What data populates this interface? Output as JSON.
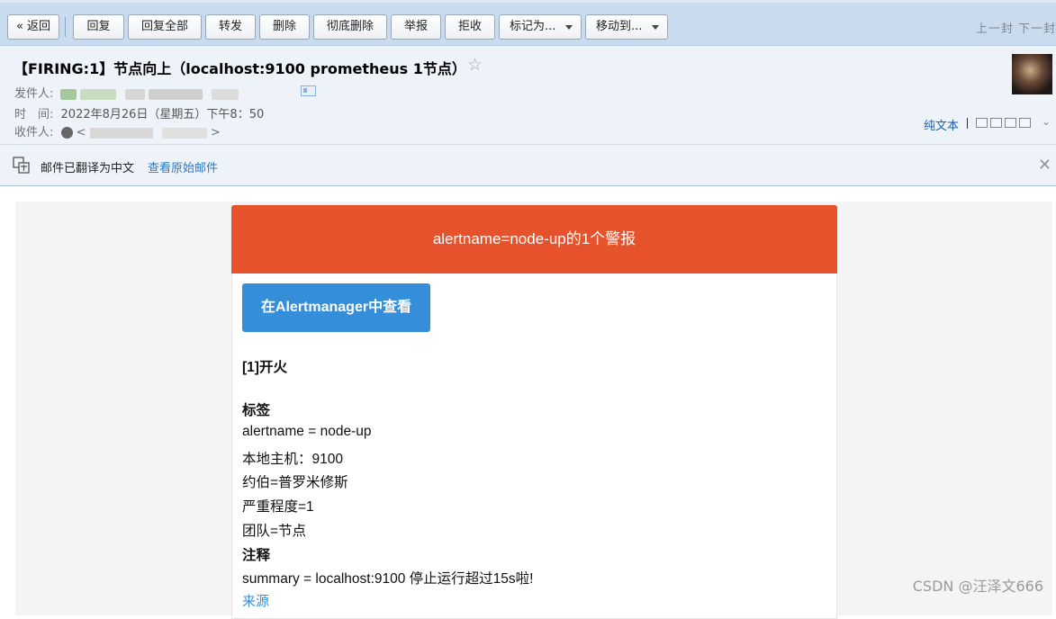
{
  "toolbar": {
    "back": "« 返回",
    "reply": "回复",
    "reply_all": "回复全部",
    "forward": "转发",
    "delete": "删除",
    "delete_permanent": "彻底删除",
    "report": "举报",
    "reject": "拒收",
    "mark_as": "标记为...",
    "move_to": "移动到...",
    "nav": "上一封 下一封"
  },
  "header": {
    "subject": "【FIRING:1】节点向上（localhost:9100 prometheus 1节点）",
    "sender_label": "发件人:",
    "time_label": "时　间:",
    "time_value": "2022年8月26日（星期五）下午8：50",
    "recipient_label": "收件人:",
    "recipient_open": "<",
    "recipient_close": ">",
    "plain_text": "纯文本",
    "star": "☆"
  },
  "translation": {
    "notice": "邮件已翻译为中文",
    "view_original": "查看原始邮件"
  },
  "email": {
    "banner": "alertname=node-up的1个警报",
    "view_button": "在Alertmanager中查看",
    "alert_heading": "[1]开火",
    "labels_heading": "标签",
    "labels": [
      "alertname = node-up",
      "本地主机：9100",
      "约伯=普罗米修斯",
      "严重程度=1",
      "团队=节点"
    ],
    "annotations_heading": "注释",
    "summary": "summary = localhost:9100 停止运行超过15s啦!",
    "source_link": "来源"
  },
  "watermark": "CSDN @汪泽文666",
  "colors": {
    "banner": "#e6522c",
    "button": "#348eda",
    "toolbar": "#c9dbef",
    "header": "#eef3f9"
  }
}
